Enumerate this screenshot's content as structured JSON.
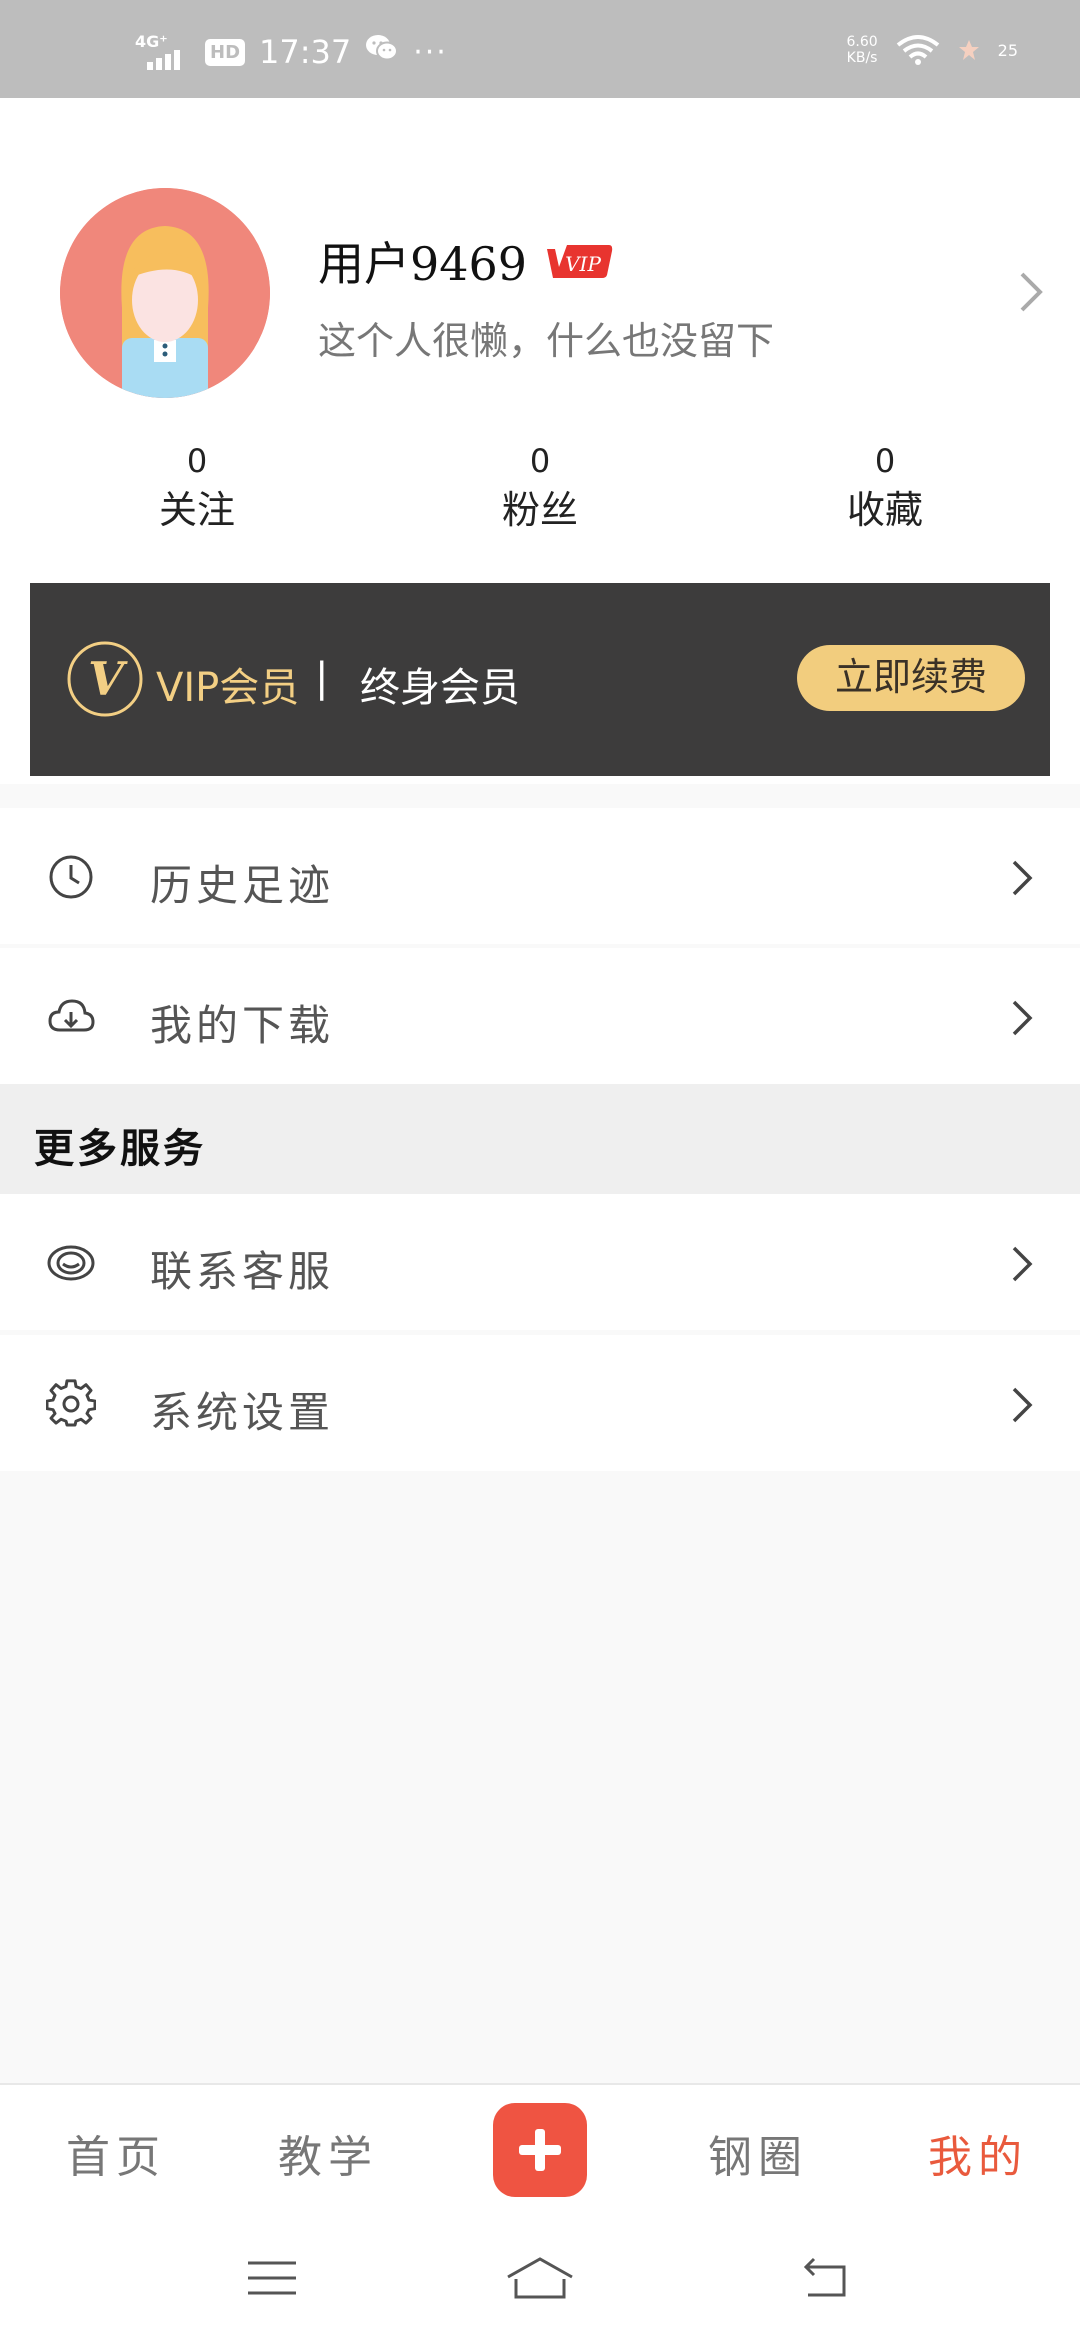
{
  "status_bar": {
    "network": "4G⁺",
    "hd": "HD",
    "time": "17:37",
    "wechat_icon": "wechat-icon",
    "more": "···",
    "speed_value": "6.60",
    "speed_unit": "KB/s",
    "battery": "25"
  },
  "profile": {
    "username": "用户9469",
    "vip_badge": "VIP",
    "bio": "这个人很懒，什么也没留下",
    "stats": [
      {
        "count": "0",
        "label": "关注"
      },
      {
        "count": "0",
        "label": "粉丝"
      },
      {
        "count": "0",
        "label": "收藏"
      }
    ]
  },
  "vip_card": {
    "logo_letter": "V",
    "title": "VIP会员",
    "separator": "|",
    "type": "终身会员",
    "button": "立即续费"
  },
  "menu": {
    "history": "历史足迹",
    "downloads": "我的下载",
    "section_title": "更多服务",
    "support": "联系客服",
    "settings": "系统设置"
  },
  "bottom_nav": {
    "home": "首页",
    "teaching": "教学",
    "circle": "钢圈",
    "mine": "我的"
  },
  "colors": {
    "accent": "#e95a3d",
    "vip_gold": "#f2cd7e",
    "vip_card_bg": "#3d3c3c"
  }
}
